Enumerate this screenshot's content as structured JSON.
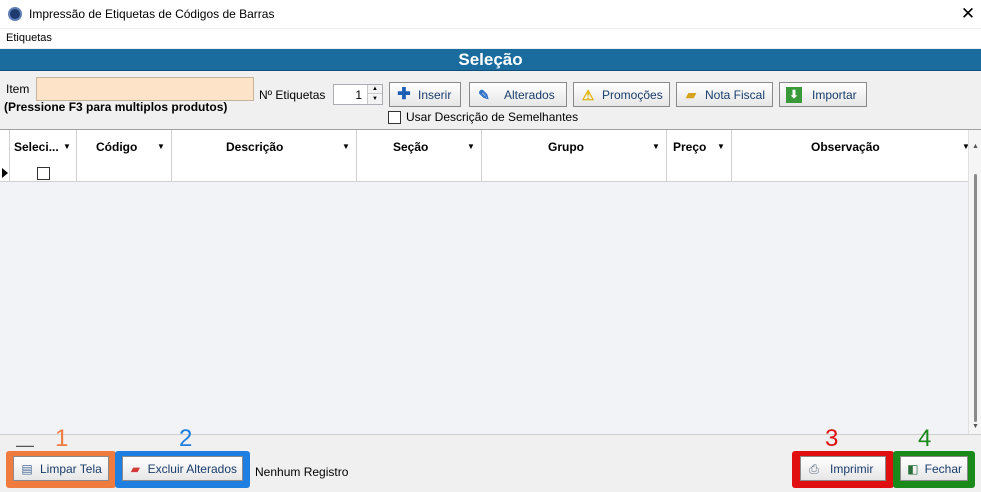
{
  "window": {
    "title": "Impressão de Etiquetas de Códigos de Barras",
    "close_glyph": "✕"
  },
  "menu": {
    "items": [
      "Etiquetas"
    ]
  },
  "section": {
    "title": "Seleção"
  },
  "form": {
    "item_label": "Item",
    "item_value": "",
    "hint": "(Pressione F3 para multiplos produtos)",
    "qty_label": "Nº Etiquetas",
    "qty_value": "1",
    "checkbox_label": "Usar Descrição de Semelhantes"
  },
  "toolbar": {
    "buttons": [
      {
        "label": "Inserir",
        "icon": "plus-icon"
      },
      {
        "label": "Alterados",
        "icon": "pen-icon"
      },
      {
        "label": "Promoções",
        "icon": "warning-icon"
      },
      {
        "label": "Nota Fiscal",
        "icon": "folder-icon"
      },
      {
        "label": "Importar",
        "icon": "download-icon"
      }
    ]
  },
  "grid": {
    "columns": [
      "Seleci...",
      "Código",
      "Descrição",
      "Seção",
      "Grupo",
      "Preço",
      "Observação"
    ]
  },
  "bottom": {
    "annotations": [
      "1",
      "2",
      "3",
      "4"
    ],
    "annotation_colors": [
      "#f07b3f",
      "#1e7fe0",
      "#e01010",
      "#1a8a1a"
    ],
    "buttons": [
      {
        "label": "Limpar Tela",
        "icon": "clear-icon"
      },
      {
        "label": "Excluir Alterados",
        "icon": "eraser-icon"
      },
      {
        "label": "Imprimir",
        "icon": "printer-icon"
      },
      {
        "label": "Fechar",
        "icon": "exit-icon"
      }
    ],
    "status": "Nenhum Registro"
  },
  "colors": {
    "header": "#1a6b9e",
    "item_input_bg": "#fde3c8",
    "button_text": "#1a3d6b"
  }
}
